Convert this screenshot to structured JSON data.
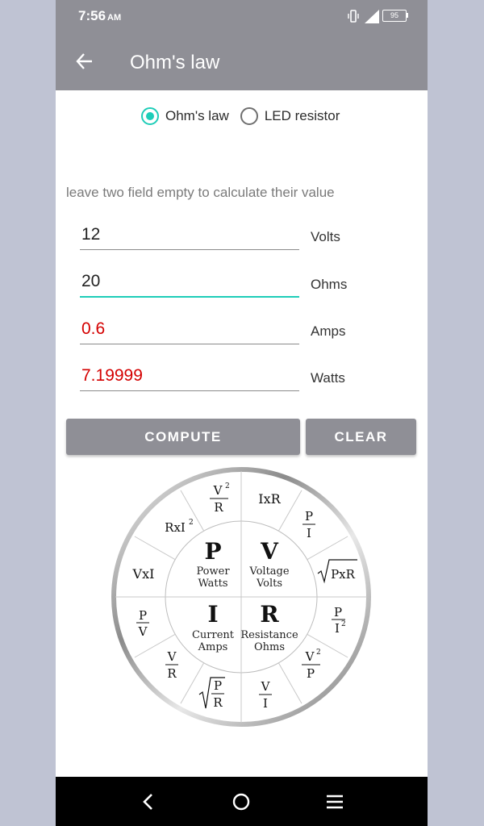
{
  "status_bar": {
    "time": "7:56",
    "ampm": "AM",
    "battery": "95"
  },
  "app_bar": {
    "title": "Ohm's law"
  },
  "mode": {
    "options": [
      {
        "label": "Ohm's law",
        "checked": true
      },
      {
        "label": "LED resistor",
        "checked": false
      }
    ]
  },
  "hint": "leave two field empty to calculate their value",
  "fields": [
    {
      "value": "12",
      "unit": "Volts",
      "state": "normal"
    },
    {
      "value": "20",
      "unit": "Ohms",
      "state": "focused"
    },
    {
      "value": "0.6",
      "unit": "Amps",
      "state": "computed"
    },
    {
      "value": "7.19999",
      "unit": "Watts",
      "state": "computed"
    }
  ],
  "buttons": {
    "compute": "COMPUTE",
    "clear": "CLEAR"
  },
  "wheel": {
    "center": {
      "p": {
        "letter": "P",
        "line1": "Power",
        "line2": "Watts"
      },
      "v": {
        "letter": "V",
        "line1": "Voltage",
        "line2": "Volts"
      },
      "i": {
        "letter": "I",
        "line1": "Current",
        "line2": "Amps"
      },
      "r": {
        "letter": "R",
        "line1": "Resistance",
        "line2": "Ohms"
      }
    },
    "formulas": {
      "v_sq_over_r": {
        "num": "V",
        "sup": "2",
        "den": "R"
      },
      "i_x_r": "IxR",
      "p_over_i": {
        "num": "P",
        "den": "I"
      },
      "r_x_i_sq": "RxI",
      "sq_sup": "2",
      "sqrt_pxr": "PxR",
      "v_x_i": "VxI",
      "p_over_v": {
        "num": "P",
        "den": "V"
      },
      "p_over_i_sq": {
        "num": "P",
        "den": "I",
        "sup": "2"
      },
      "v_over_r": {
        "num": "V",
        "den": "R"
      },
      "sqrt_p_over_r": {
        "num": "P",
        "den": "R"
      },
      "v_over_i": {
        "num": "V",
        "den": "I"
      },
      "v_sq_over_p": {
        "num": "V",
        "sup": "2",
        "den": "P"
      }
    }
  },
  "colors": {
    "accent": "#1ecdb8",
    "bar": "#8f8f96",
    "computed_text": "#d40000"
  }
}
